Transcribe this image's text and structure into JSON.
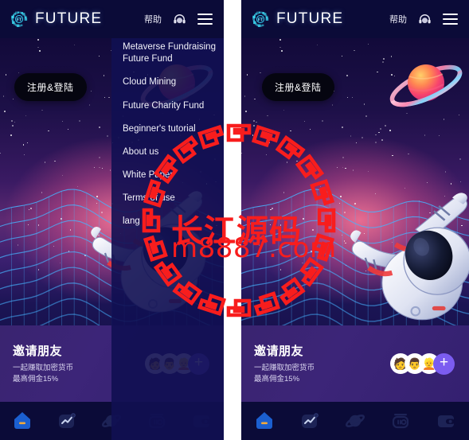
{
  "header": {
    "brand": "FUTURE",
    "logo_text": "FT",
    "help_label": "帮助",
    "support_icon": "headset-icon",
    "menu_icon": "hamburger-menu-icon"
  },
  "hero": {
    "cta_label": "注册&登陆",
    "planet_icon": "saturn-planet-icon",
    "astronaut_icon": "astronaut-icon",
    "terrain_icon": "wireframe-terrain-icon"
  },
  "dropdown": {
    "items": [
      {
        "label": "Metaverse Fundraising Future Fund"
      },
      {
        "label": "Cloud Mining"
      },
      {
        "label": "Future Charity Fund"
      },
      {
        "label": "Beginner's tutorial"
      },
      {
        "label": "About us"
      },
      {
        "label": "White Paper"
      },
      {
        "label": "Terms of use"
      },
      {
        "label": "lang"
      }
    ]
  },
  "invite": {
    "title": "邀请朋友",
    "subtitle_line1": "一起赚取加密货币",
    "subtitle_line2": "最高佣金15%",
    "add_label": "+",
    "avatars": [
      "🧑",
      "👨",
      "👱"
    ]
  },
  "navbar": {
    "items": [
      {
        "name": "home",
        "icon": "home-icon",
        "active": true
      },
      {
        "name": "market",
        "icon": "chart-trend-icon",
        "active": false
      },
      {
        "name": "planet",
        "icon": "planet-icon",
        "active": false
      },
      {
        "name": "vault",
        "icon": "safe-vault-icon",
        "active": false
      },
      {
        "name": "wallet",
        "icon": "wallet-icon",
        "active": false
      }
    ]
  },
  "watermark": {
    "text_cn": "长江源码",
    "text_url": "m8887.com",
    "color": "#f81d1d"
  },
  "colors": {
    "header_bg": "#0b0b38",
    "accent_purple": "#7b5cf0",
    "hero_pink": "#ff7896",
    "grid_cyan": "#3fa9f5",
    "home_active": "#1b5fd0",
    "home_bar": "#f2a93b"
  }
}
